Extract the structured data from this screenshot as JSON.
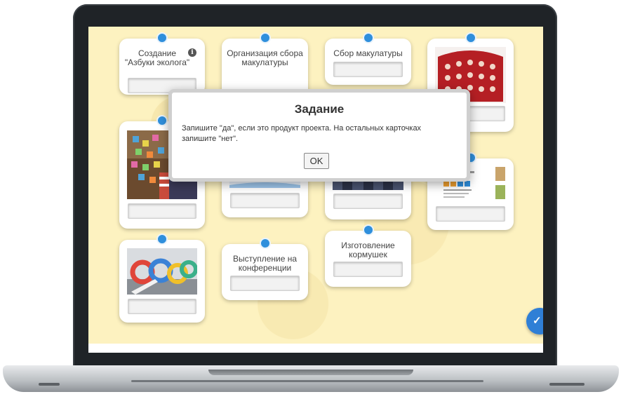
{
  "cards": {
    "c1": {
      "label": "Создание \"Азбуки эколога\"",
      "info_icon": "info-icon"
    },
    "c2": {
      "label": "Организация сбора макулатуры"
    },
    "c3": {
      "label": "Сбор макулатуры"
    },
    "c4": {
      "image": "red-advent-calendar-image"
    },
    "c5": {
      "image": "decorated-tree-image"
    },
    "c6": {
      "image": "blue-craft-image"
    },
    "c7": {
      "image": "people-photo-image"
    },
    "c8": {
      "image": "leaflet-document-image"
    },
    "c9": {
      "image": "tire-playground-image"
    },
    "c10": {
      "label": "Выступление на конференции"
    },
    "c11": {
      "label": "Изготовление кормушек"
    }
  },
  "modal": {
    "title": "Задание",
    "text": "Запишите \"да\", если это продукт проекта. На остальных карточках запишите \"нет\".",
    "ok_label": "OK"
  },
  "check_button": {
    "icon": "check-icon"
  },
  "colors": {
    "background": "#fdf2c0",
    "pin": "#2f8fdc",
    "accent": "#2f7fd6"
  }
}
